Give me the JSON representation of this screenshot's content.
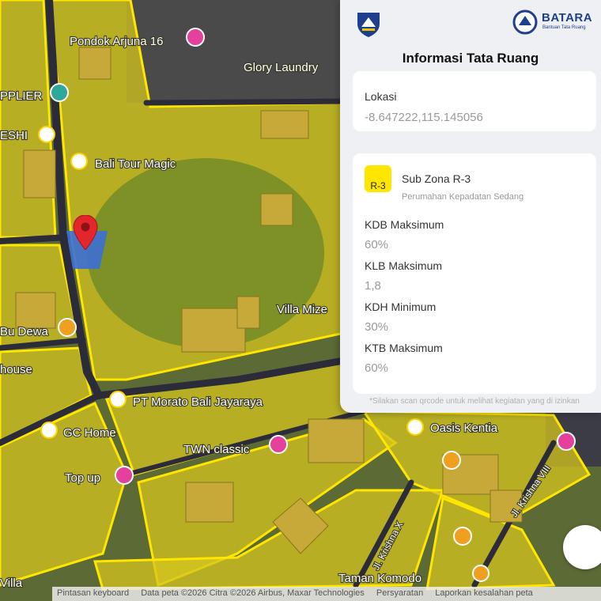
{
  "panel": {
    "title": "Informasi Tata Ruang",
    "brand": {
      "name": "BATARA",
      "tagline": "Bantuan Tata Ruang"
    },
    "location": {
      "label": "Lokasi",
      "value": "-8.647222,115.145056"
    },
    "zone": {
      "code": "R-3",
      "name": "Sub Zona R-3",
      "description": "Perumahan Kepadatan Sedang",
      "badge_color": "#ffe600",
      "metrics": [
        {
          "label": "KDB Maksimum",
          "value": "60%"
        },
        {
          "label": "KLB Maksimum",
          "value": "1,8"
        },
        {
          "label": "KDH Minimum",
          "value": "30%"
        },
        {
          "label": "KTB Maksimum",
          "value": "60%"
        }
      ]
    },
    "note": "*Silakan scan qrcode untuk melihat kegiatan yang di izinkan"
  },
  "map": {
    "zone_color": "#ffe600",
    "labels": {
      "pondok_arjuna": "Pondok Arjuna 16",
      "glory_laundry": "Glory Laundry",
      "bali_tour_magic": "Bali Tour Magic",
      "villa_mize": "Villa Mize",
      "pt_morato": "PT Morato Bali Jayaraya",
      "gc_home": "GC Home",
      "twn_classic": "TWN classic",
      "oasis_kentia": "Oasis Kentia",
      "top_up": "Top up",
      "bu_dewa": "Bu Dewa",
      "house": "house",
      "esh": "ESHI",
      "pplier": "PPLIER",
      "villa": "Villa",
      "jl_krishna_x": "Jl. Krishna X",
      "jl_krishna_viii": "Jl. Krishna VIII",
      "taman_komodo": "Taman Komodo"
    }
  },
  "attribution": {
    "items": [
      "Pintasan keyboard",
      "Data peta ©2026 Citra ©2026 Airbus, Maxar Technologies",
      "Persyaratan",
      "Laporkan kesalahan peta"
    ]
  }
}
